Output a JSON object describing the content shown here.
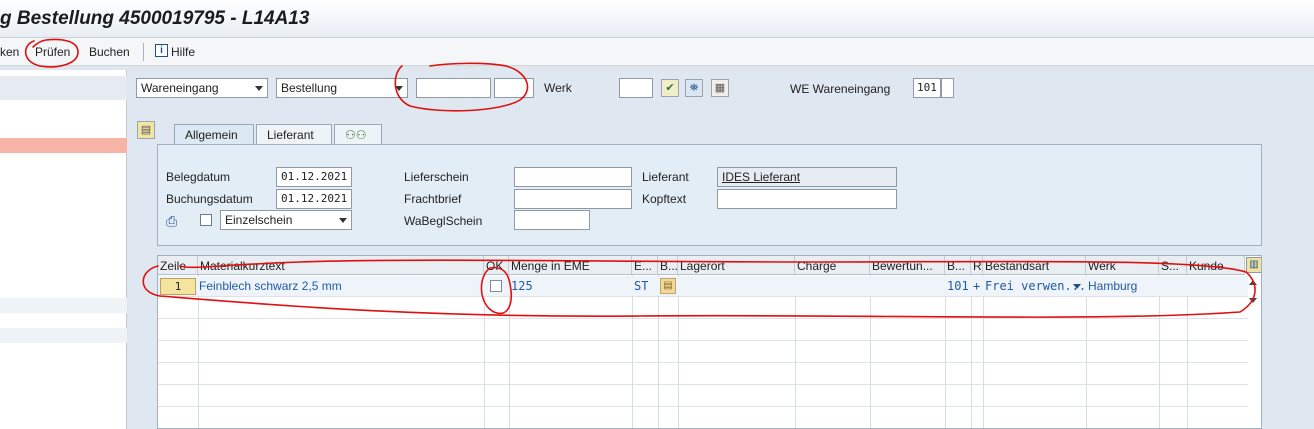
{
  "window": {
    "title": "g Bestellung 4500019795 - L14A13"
  },
  "toolbar": {
    "item1": "ken",
    "pruefen": "Prüfen",
    "buchen": "Buchen",
    "hilfe": "Hilfe"
  },
  "header": {
    "action": "Wareneingang",
    "reference": "Bestellung",
    "po_number": "",
    "po_item": "",
    "werk_label": "Werk",
    "werk_value": "",
    "movement_label": "WE Wareneingang",
    "movement_value": "101"
  },
  "tabs": [
    {
      "label": "Allgemein"
    },
    {
      "label": "Lieferant"
    }
  ],
  "general": {
    "belegdatum_label": "Belegdatum",
    "belegdatum": "01.12.2021",
    "buchungsdatum_label": "Buchungsdatum",
    "buchungsdatum": "01.12.2021",
    "print_option": "Einzelschein",
    "lieferschein_label": "Lieferschein",
    "frachtbrief_label": "Frachtbrief",
    "wabeglschein_label": "WaBeglSchein",
    "lieferant_label": "Lieferant",
    "lieferant_value": "IDES Lieferant",
    "kopftext_label": "Kopftext"
  },
  "grid": {
    "columns": [
      "Zeile",
      "Materialkurztext",
      "OK",
      "Menge in EME",
      "E...",
      "B...",
      "Lagerort",
      "Charge",
      "Bewertun...",
      "B...",
      "R",
      "Bestandsart",
      "Werk",
      "S...",
      "Kunde"
    ],
    "row": {
      "zeile": "1",
      "material": "Feinblech schwarz 2,5 mm",
      "menge": "125",
      "einheit": "ST",
      "bwart": "101",
      "plus": "+",
      "bestandsart": "Frei verwen...",
      "werk": "Hamburg"
    }
  },
  "colors": {
    "accent": "#1f5aa8",
    "annotation": "#e01010",
    "selected_row": "#f7d6cc"
  },
  "icons": [
    "info-icon",
    "check-icon",
    "binoculars-icon",
    "table-icon",
    "printer-icon",
    "partner-icon",
    "header-toggle-icon",
    "column-layout-icon"
  ]
}
